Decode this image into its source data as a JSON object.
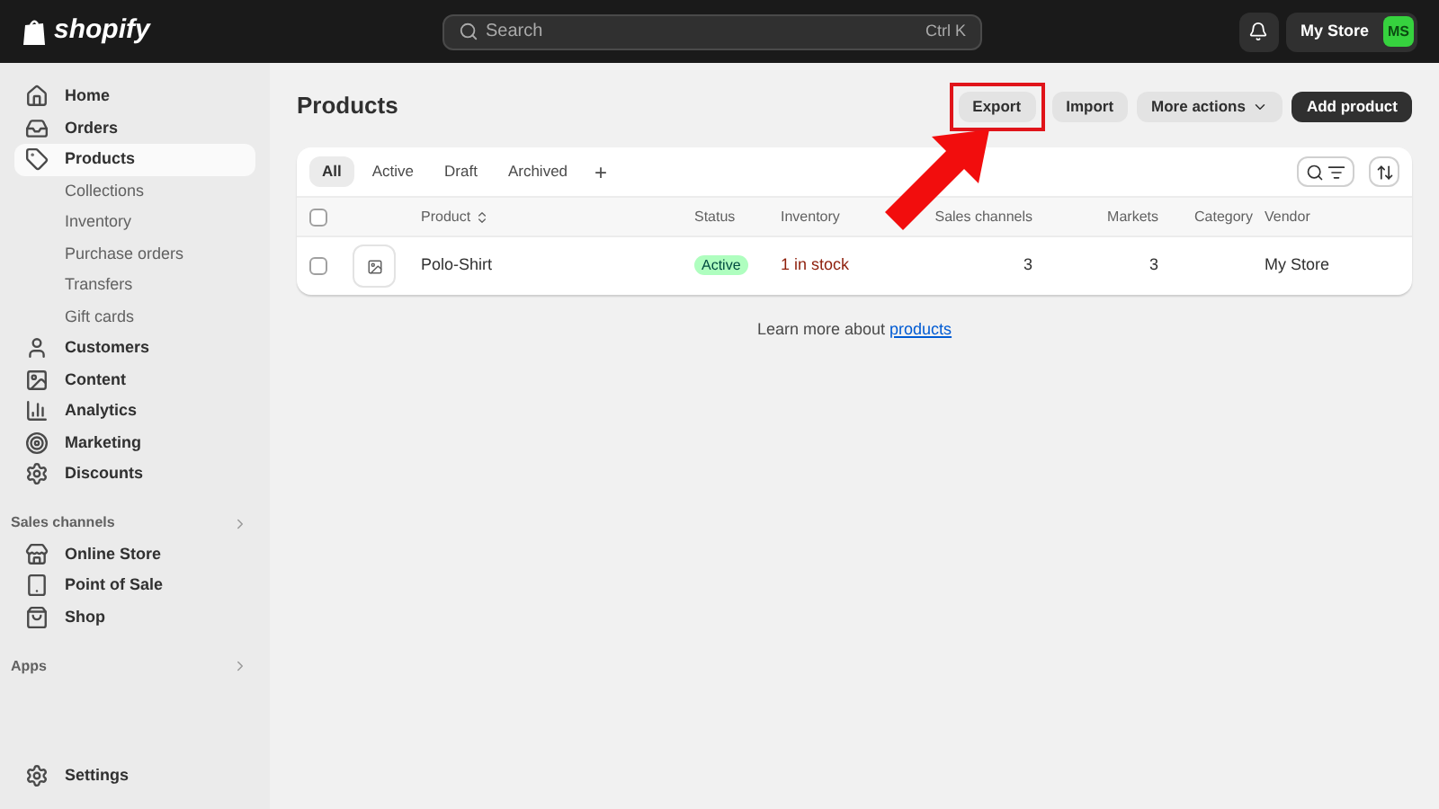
{
  "topbar": {
    "logo": "shopify",
    "search": {
      "placeholder": "Search",
      "shortcut": "Ctrl K"
    },
    "store": {
      "name": "My Store",
      "initials": "MS"
    }
  },
  "sidebar": {
    "items": [
      {
        "label": "Home",
        "selected": false
      },
      {
        "label": "Orders",
        "selected": false
      },
      {
        "label": "Products",
        "selected": true,
        "children": [
          {
            "label": "Collections"
          },
          {
            "label": "Inventory"
          },
          {
            "label": "Purchase orders"
          },
          {
            "label": "Transfers"
          },
          {
            "label": "Gift cards"
          }
        ]
      },
      {
        "label": "Customers",
        "selected": false
      },
      {
        "label": "Content",
        "selected": false
      },
      {
        "label": "Analytics",
        "selected": false
      },
      {
        "label": "Marketing",
        "selected": false
      },
      {
        "label": "Discounts",
        "selected": false
      }
    ],
    "sections": [
      {
        "title": "Sales channels",
        "items": [
          {
            "label": "Online Store"
          },
          {
            "label": "Point of Sale"
          },
          {
            "label": "Shop"
          }
        ]
      },
      {
        "title": "Apps"
      }
    ],
    "settings": "Settings"
  },
  "page": {
    "title": "Products",
    "actions": [
      {
        "label": "Export",
        "kind": "secondary",
        "highlighted": true
      },
      {
        "label": "Import",
        "kind": "secondary",
        "highlighted": false
      },
      {
        "label": "More actions",
        "kind": "menu",
        "highlighted": false
      },
      {
        "label": "Add product",
        "kind": "primary",
        "highlighted": false
      }
    ],
    "tabs": [
      {
        "label": "All",
        "selected": true
      },
      {
        "label": "Active",
        "selected": false
      },
      {
        "label": "Draft",
        "selected": false
      },
      {
        "label": "Archived",
        "selected": false
      }
    ],
    "add_tab": "+",
    "table": {
      "select_all": {
        "checked": false
      },
      "columns": [
        "Product",
        "Status",
        "Inventory",
        "Sales channels",
        "Markets",
        "Category",
        "Vendor"
      ],
      "rows": [
        {
          "checked": false,
          "product": "Polo-Shirt",
          "status": "Active",
          "inventory": "1 in stock",
          "sales_channels": "3",
          "markets": "3",
          "vendor": "My Store"
        }
      ]
    },
    "footer": {
      "text": "Learn more about",
      "link": "products"
    }
  }
}
